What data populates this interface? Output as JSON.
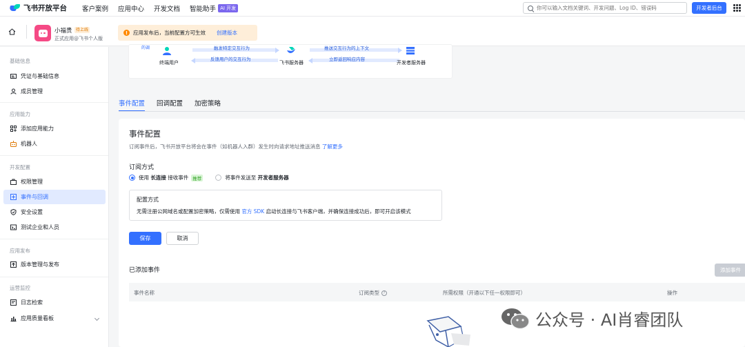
{
  "topnav": {
    "logo_text": "飞书开放平台",
    "links": [
      "客户案例",
      "应用中心",
      "开发文档",
      "智能助手"
    ],
    "ai_badge": "AI 开发",
    "search_placeholder": "你可以输入文档关键词、开发问题、Log ID、错误码",
    "dev_console": "开发者后台"
  },
  "app": {
    "name": "小福贵",
    "status": "待上线",
    "subtitle": "正式应用@飞书个人版",
    "notice_text": "应用发布后，当前配置方可生效",
    "notice_link": "创建版本"
  },
  "sidebar": {
    "sections": [
      {
        "title": "基础信息",
        "items": [
          {
            "label": "凭证与基础信息",
            "icon": "credential-icon"
          },
          {
            "label": "成员管理",
            "icon": "member-icon"
          }
        ]
      },
      {
        "title": "应用能力",
        "items": [
          {
            "label": "添加应用能力",
            "icon": "add-capability-icon"
          },
          {
            "label": "机器人",
            "icon": "robot-icon"
          }
        ]
      },
      {
        "title": "开发配置",
        "items": [
          {
            "label": "权限管理",
            "icon": "permission-icon"
          },
          {
            "label": "事件与回调",
            "icon": "event-icon",
            "active": true
          },
          {
            "label": "安全设置",
            "icon": "security-icon"
          },
          {
            "label": "测试企业和人员",
            "icon": "test-icon"
          }
        ]
      },
      {
        "title": "应用发布",
        "items": [
          {
            "label": "版本管理与发布",
            "icon": "release-icon"
          }
        ]
      },
      {
        "title": "运营监控",
        "items": [
          {
            "label": "日志检索",
            "icon": "log-icon"
          },
          {
            "label": "应用质量看板",
            "icon": "dashboard-icon"
          }
        ]
      }
    ]
  },
  "diagram": {
    "corner_tag": "的调",
    "nodes": [
      "终端用户",
      "飞书服务器",
      "开发者服务器"
    ],
    "arrows": [
      "触发特定交互行为",
      "反馈用户的交互行为",
      "推送交互行为的上下文",
      "立即返回响应内容"
    ]
  },
  "tabs": [
    "事件配置",
    "回调配置",
    "加密策略"
  ],
  "config": {
    "title": "事件配置",
    "desc": "订阅事件后，飞书开放平台将会在事件（如机器人入群）发生时向请求地址推送消息",
    "desc_link": "了解更多",
    "subscribe_title": "订阅方式",
    "option1_prefix": "使用",
    "option1_bold": "长连接",
    "option1_suffix": "接收事件",
    "recommend": "推荐",
    "option2_prefix": "将事件发送至",
    "option2_bold": "开发者服务器",
    "mode_title": "配置方式",
    "mode_text_a": "无需注册公网域名或配置加密策略，仅需使用",
    "mode_link": "官方 SDK",
    "mode_text_b": "启动长连接与飞书客户端，并确保连接成功后，即可开启该模式",
    "save": "保存",
    "cancel": "取消",
    "added_title": "已添加事件",
    "add_event": "添加事件",
    "columns": [
      "事件名称",
      "订阅类型",
      "所需权限（开通以下任一权限即可）",
      "操作"
    ]
  },
  "watermark": "公众号 · AI肖睿团队"
}
